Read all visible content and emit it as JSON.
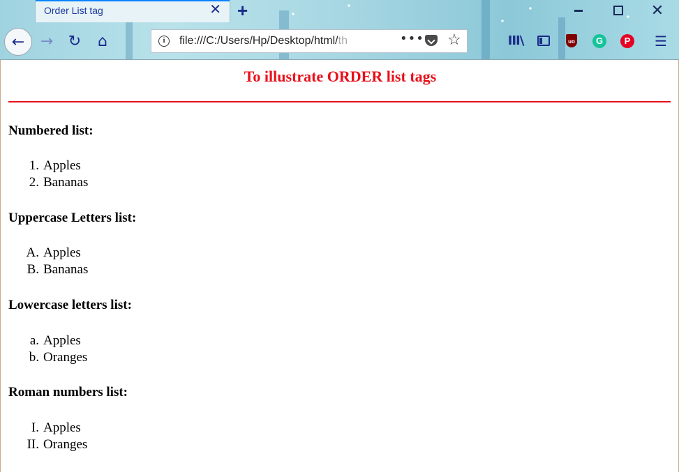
{
  "browser": {
    "tab_title": "Order List tag",
    "tab_close": "✕",
    "new_tab": "+",
    "url_main": "file:///C:/Users/Hp/Desktop/html/",
    "url_faded": "th",
    "window_close": "✕",
    "nav": {
      "back": "←",
      "forward": "→",
      "reload": "↻",
      "home": "⌂"
    },
    "more": "•••",
    "star": "☆",
    "library": "III\\",
    "menu": "☰"
  },
  "page": {
    "title": "To illustrate ORDER list tags",
    "sections": [
      {
        "heading": "Numbered list:",
        "items": [
          {
            "marker": "1.",
            "text": "Apples"
          },
          {
            "marker": "2.",
            "text": "Bananas"
          }
        ]
      },
      {
        "heading": "Uppercase Letters list:",
        "items": [
          {
            "marker": "A.",
            "text": "Apples"
          },
          {
            "marker": "B.",
            "text": "Bananas"
          }
        ]
      },
      {
        "heading": "Lowercase letters list:",
        "items": [
          {
            "marker": "a.",
            "text": "Apples"
          },
          {
            "marker": "b.",
            "text": "Oranges"
          }
        ]
      },
      {
        "heading": "Roman numbers list:",
        "items": [
          {
            "marker": "I.",
            "text": "Apples"
          },
          {
            "marker": "II.",
            "text": "Oranges"
          }
        ]
      }
    ]
  },
  "colors": {
    "title": "#e8101a",
    "accent": "#0a84ff"
  }
}
